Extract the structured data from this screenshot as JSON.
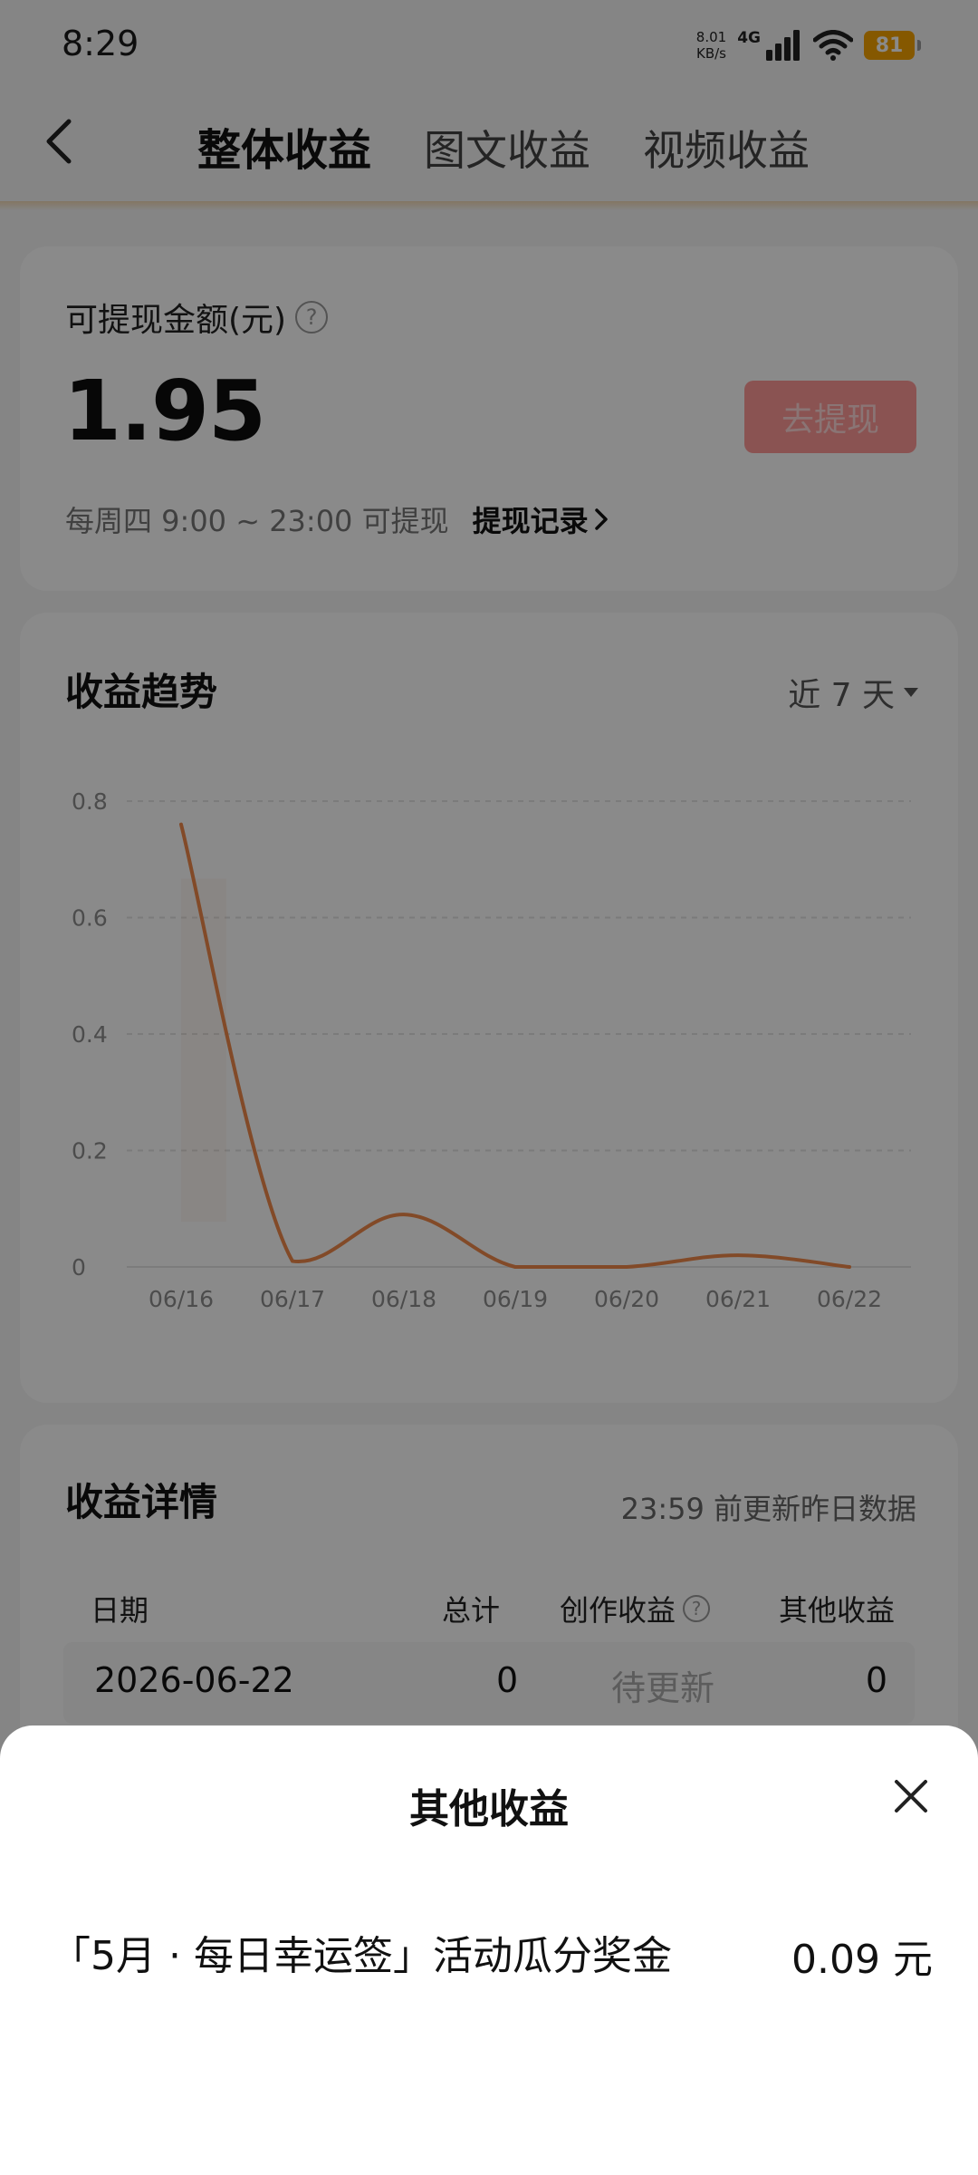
{
  "status": {
    "time": "8:29",
    "net_speed_value": "8.01",
    "net_speed_unit": "KB/s",
    "network": "4G",
    "battery": "81"
  },
  "nav": {
    "tabs": [
      "整体收益",
      "图文收益",
      "视频收益"
    ],
    "active_tab": 0
  },
  "withdraw_card": {
    "label": "可提现金额(元)",
    "help": "?",
    "amount": "1.95",
    "button": "去提现",
    "schedule": "每周四 9:00 ~ 23:00 可提现",
    "records_link": "提现记录"
  },
  "trend_card": {
    "title": "收益趋势",
    "range": "近 7 天"
  },
  "chart_data": {
    "type": "line",
    "x": [
      "06/16",
      "06/17",
      "06/18",
      "06/19",
      "06/20",
      "06/21",
      "06/22"
    ],
    "values": [
      0.76,
      0.01,
      0.09,
      0.0,
      0.0,
      0.02,
      0.0
    ],
    "yticks": [
      "0.8",
      "0.6",
      "0.4",
      "0.2",
      "0"
    ],
    "ylim": [
      0,
      0.8
    ],
    "grid": true,
    "line_color": "#f08a4b"
  },
  "details_card": {
    "title": "收益详情",
    "note": "23:59 前更新昨日数据",
    "columns": [
      "日期",
      "总计",
      "创作收益",
      "其他收益"
    ],
    "rows": [
      {
        "date": "2026-06-22",
        "total": "0",
        "creation": "待更新",
        "other": "0"
      }
    ]
  },
  "sheet": {
    "title": "其他收益",
    "item_label": "「5月 · 每日幸运签」活动瓜分奖金",
    "item_value": "0.09 元"
  }
}
